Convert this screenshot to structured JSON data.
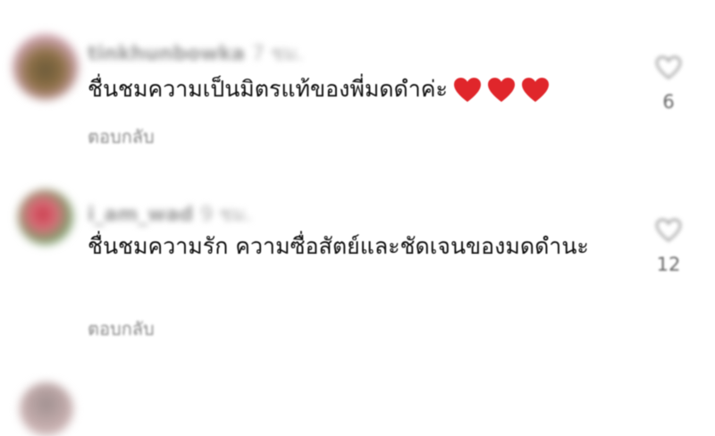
{
  "comments": [
    {
      "username": "tinkhunbowka",
      "time": "7 ชม.",
      "text": "ชื่นชมความเป็นมิตรแท้ของพี่มดดำค่ะ",
      "emoji": "❤️❤️❤️",
      "reply_label": "ตอบกลับ",
      "likes": "6"
    },
    {
      "username": "i_am_wad",
      "time": "9 ชม.",
      "text": "ชื่นชมความรัก ความซื่อสัตย์และชัดเจนของมดดำนะ",
      "reply_label": "ตอบกลับ",
      "likes": "12"
    },
    {
      "username": "",
      "time": ""
    }
  ],
  "colors": {
    "heart": "#e0262b",
    "secondary_text": "#8a8a8a"
  }
}
